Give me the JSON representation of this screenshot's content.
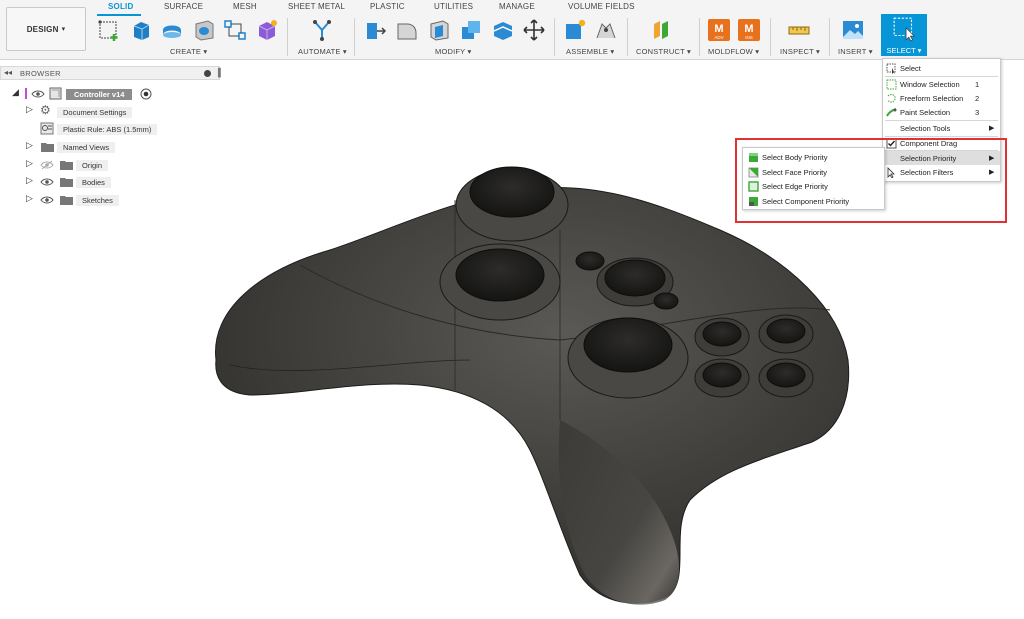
{
  "toolbar": {
    "design_label": "DESIGN",
    "tabs": [
      "SOLID",
      "SURFACE",
      "MESH",
      "SHEET METAL",
      "PLASTIC",
      "UTILITIES",
      "MANAGE",
      "VOLUME FIELDS"
    ],
    "groups": {
      "create": "CREATE ▾",
      "automate": "AUTOMATE ▾",
      "modify": "MODIFY ▾",
      "assemble": "ASSEMBLE ▾",
      "construct": "CONSTRUCT ▾",
      "moldflow": "MOLDFLOW ▾",
      "inspect": "INSPECT ▾",
      "insert": "INSERT ▾",
      "select": "SELECT ▾"
    },
    "moldflow_badges": [
      "ADV",
      "INS"
    ],
    "colors": {
      "accent": "#0696d7",
      "moldflow": "#e8711e"
    }
  },
  "browser": {
    "title": "BROWSER",
    "items": [
      {
        "label": "Controller v14",
        "icon": "component-icon"
      },
      {
        "label": "Document Settings",
        "icon": "gear-icon"
      },
      {
        "label": "Plastic Rule: ABS (1.5mm)",
        "icon": "plastic-rule-icon"
      },
      {
        "label": "Named Views",
        "icon": "folder-icon"
      },
      {
        "label": "Origin",
        "icon": "folder-icon"
      },
      {
        "label": "Bodies",
        "icon": "folder-icon"
      },
      {
        "label": "Sketches",
        "icon": "folder-icon"
      }
    ]
  },
  "select_menu": {
    "items": [
      {
        "label": "Select",
        "key": ""
      },
      {
        "label": "Window Selection",
        "key": "1"
      },
      {
        "label": "Freeform Selection",
        "key": "2"
      },
      {
        "label": "Paint Selection",
        "key": "3"
      },
      {
        "label": "Selection Tools",
        "key": ""
      },
      {
        "label": "Component Drag",
        "key": ""
      },
      {
        "label": "Selection Priority",
        "key": ""
      },
      {
        "label": "Selection Filters",
        "key": ""
      }
    ]
  },
  "priority_menu": {
    "items": [
      {
        "label": "Select Body Priority"
      },
      {
        "label": "Select Face Priority"
      },
      {
        "label": "Select Edge Priority"
      },
      {
        "label": "Select Component Priority"
      }
    ]
  },
  "annotation": {
    "highlight_color": "#e03232"
  }
}
